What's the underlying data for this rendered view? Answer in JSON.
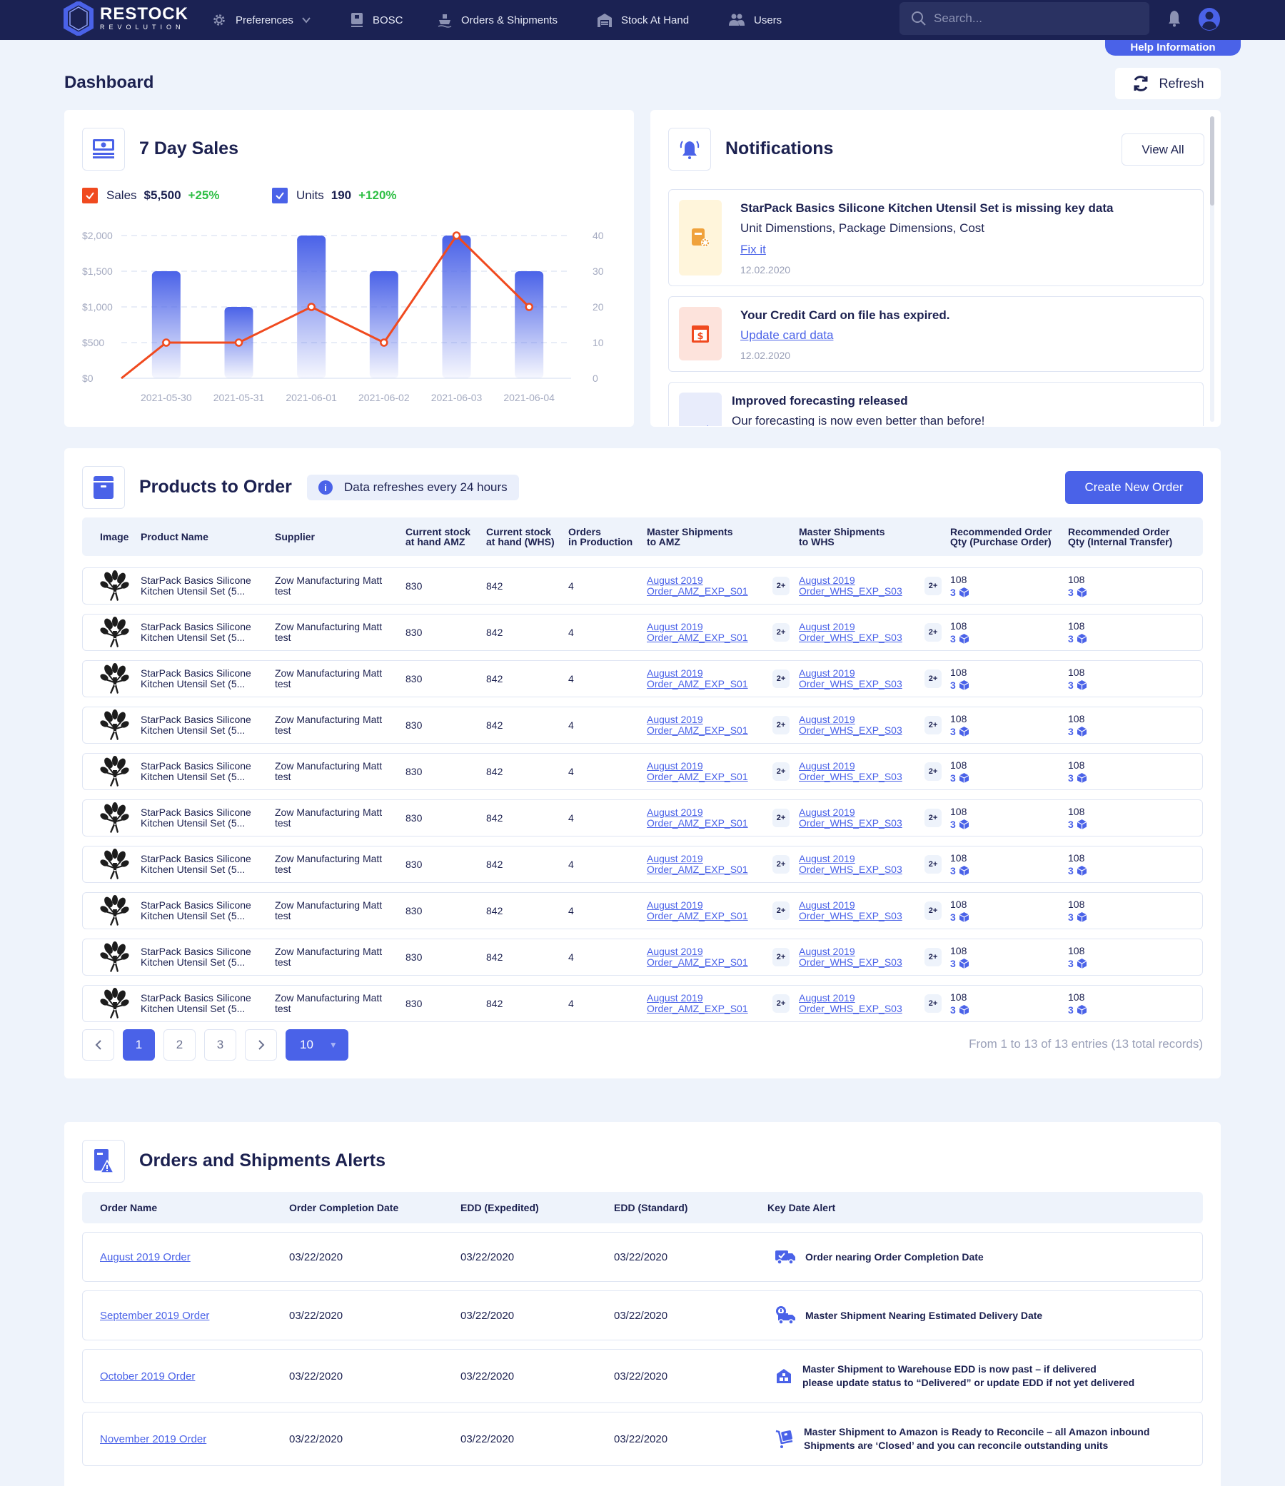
{
  "nav": {
    "logo_main": "RESTOCK",
    "logo_sub": "REVOLUTION",
    "items": [
      {
        "label": "Preferences",
        "icon": "gear-icon",
        "has_dropdown": true
      },
      {
        "label": "BOSC",
        "icon": "book-icon"
      },
      {
        "label": "Orders & Shipments",
        "icon": "ship-icon"
      },
      {
        "label": "Stock At Hand",
        "icon": "warehouse-icon"
      },
      {
        "label": "Users",
        "icon": "users-icon"
      }
    ],
    "search_placeholder": "Search...",
    "help_label": "Help Information"
  },
  "page": {
    "title": "Dashboard",
    "refresh_label": "Refresh"
  },
  "sales": {
    "title": "7 Day Sales",
    "legend": [
      {
        "label": "Sales",
        "value": "$5,500",
        "change": "+25%",
        "color": "#f04a1f"
      },
      {
        "label": "Units",
        "value": "190",
        "change": "+120%",
        "color": "#4a62e8"
      }
    ]
  },
  "chart_data": {
    "type": "bar",
    "title": "7 Day Sales",
    "categories": [
      "2021-05-30",
      "2021-05-31",
      "2021-06-01",
      "2021-06-02",
      "2021-06-03",
      "2021-06-04"
    ],
    "series": [
      {
        "name": "Sales",
        "type": "bar",
        "axis": "left",
        "values": [
          1500,
          1000,
          2000,
          1500,
          2000,
          1500
        ],
        "color": "#4a62e8"
      },
      {
        "name": "Units",
        "type": "line",
        "axis": "right",
        "start_value": 0,
        "values": [
          10,
          10,
          20,
          10,
          40,
          20
        ],
        "color": "#f04a1f"
      }
    ],
    "y_left": {
      "ticks": [
        "$0",
        "$500",
        "$1,000",
        "$1,500",
        "$2,000"
      ],
      "range": [
        0,
        2000
      ]
    },
    "y_right": {
      "ticks": [
        "0",
        "10",
        "20",
        "30",
        "40"
      ],
      "range": [
        0,
        40
      ]
    },
    "grid": true,
    "xlabel": "",
    "ylabel": ""
  },
  "notifications": {
    "title": "Notifications",
    "view_all_label": "View All",
    "items": [
      {
        "title": "StarPack Basics Silicone Kitchen Utensil Set is missing key data",
        "text": "Unit Dimenstions, Package Dimensions, Cost",
        "link": "Fix it",
        "date": "12.02.2020",
        "icon": "document-gear-icon",
        "bg": "#fff5db",
        "fg": "#f0a23c"
      },
      {
        "title": "Your Credit Card on file has expired.",
        "text": "",
        "link": "Update card data",
        "date": "12.02.2020",
        "icon": "card-dollar-icon",
        "bg": "#fde3dc",
        "fg": "#f04a1f"
      },
      {
        "title": "Improved forecasting released",
        "text": "Our forecasting is now even better than before!",
        "link": "",
        "date": "",
        "icon": "chart-icon",
        "bg": "#e8ecfb",
        "fg": "#4a62e8"
      }
    ]
  },
  "products": {
    "title": "Products to Order",
    "info": "Data refreshes every 24 hours",
    "create_label": "Create New Order",
    "headers": [
      "Image",
      "Product Name",
      "Supplier",
      "Current stock\nat hand AMZ",
      "Current stock\nat hand (WHS)",
      "Orders\nin Production",
      "Master Shipments\nto AMZ",
      "Master Shipments\nto WHS",
      "Recommended Order\nQty (Purchase Order)",
      "Recommended Order\nQty (Internal Transfer)"
    ],
    "rows": [
      {
        "name1": "StarPack Basics Silicone",
        "name2": "Kitchen Utensil Set (5...",
        "supplier1": "Zow Manufacturing Matt",
        "supplier2": "test",
        "amz": "830",
        "whs": "842",
        "prod": "4",
        "ms_amz1": "August 2019",
        "ms_amz2": "Order_AMZ_EXP_S01",
        "ms_amz_more": "2+",
        "ms_whs1": "August 2019",
        "ms_whs2": "Order_WHS_EXP_S03",
        "ms_whs_more": "2+",
        "po_qty": "108",
        "po_boxes": "3",
        "it_qty": "108",
        "it_boxes": "3"
      },
      {
        "name1": "StarPack Basics Silicone",
        "name2": "Kitchen Utensil Set (5...",
        "supplier1": "Zow Manufacturing Matt",
        "supplier2": "test",
        "amz": "830",
        "whs": "842",
        "prod": "4",
        "ms_amz1": "August 2019",
        "ms_amz2": "Order_AMZ_EXP_S01",
        "ms_amz_more": "2+",
        "ms_whs1": "August 2019",
        "ms_whs2": "Order_WHS_EXP_S03",
        "ms_whs_more": "2+",
        "po_qty": "108",
        "po_boxes": "3",
        "it_qty": "108",
        "it_boxes": "3"
      },
      {
        "name1": "StarPack Basics Silicone",
        "name2": "Kitchen Utensil Set (5...",
        "supplier1": "Zow Manufacturing Matt",
        "supplier2": "test",
        "amz": "830",
        "whs": "842",
        "prod": "4",
        "ms_amz1": "August 2019",
        "ms_amz2": "Order_AMZ_EXP_S01",
        "ms_amz_more": "2+",
        "ms_whs1": "August 2019",
        "ms_whs2": "Order_WHS_EXP_S03",
        "ms_whs_more": "2+",
        "po_qty": "108",
        "po_boxes": "3",
        "it_qty": "108",
        "it_boxes": "3"
      },
      {
        "name1": "StarPack Basics Silicone",
        "name2": "Kitchen Utensil Set (5...",
        "supplier1": "Zow Manufacturing Matt",
        "supplier2": "test",
        "amz": "830",
        "whs": "842",
        "prod": "4",
        "ms_amz1": "August 2019",
        "ms_amz2": "Order_AMZ_EXP_S01",
        "ms_amz_more": "2+",
        "ms_whs1": "August 2019",
        "ms_whs2": "Order_WHS_EXP_S03",
        "ms_whs_more": "2+",
        "po_qty": "108",
        "po_boxes": "3",
        "it_qty": "108",
        "it_boxes": "3"
      },
      {
        "name1": "StarPack Basics Silicone",
        "name2": "Kitchen Utensil Set (5...",
        "supplier1": "Zow Manufacturing Matt",
        "supplier2": "test",
        "amz": "830",
        "whs": "842",
        "prod": "4",
        "ms_amz1": "August 2019",
        "ms_amz2": "Order_AMZ_EXP_S01",
        "ms_amz_more": "2+",
        "ms_whs1": "August 2019",
        "ms_whs2": "Order_WHS_EXP_S03",
        "ms_whs_more": "2+",
        "po_qty": "108",
        "po_boxes": "3",
        "it_qty": "108",
        "it_boxes": "3"
      },
      {
        "name1": "StarPack Basics Silicone",
        "name2": "Kitchen Utensil Set (5...",
        "supplier1": "Zow Manufacturing Matt",
        "supplier2": "test",
        "amz": "830",
        "whs": "842",
        "prod": "4",
        "ms_amz1": "August 2019",
        "ms_amz2": "Order_AMZ_EXP_S01",
        "ms_amz_more": "2+",
        "ms_whs1": "August 2019",
        "ms_whs2": "Order_WHS_EXP_S03",
        "ms_whs_more": "2+",
        "po_qty": "108",
        "po_boxes": "3",
        "it_qty": "108",
        "it_boxes": "3"
      },
      {
        "name1": "StarPack Basics Silicone",
        "name2": "Kitchen Utensil Set (5...",
        "supplier1": "Zow Manufacturing Matt",
        "supplier2": "test",
        "amz": "830",
        "whs": "842",
        "prod": "4",
        "ms_amz1": "August 2019",
        "ms_amz2": "Order_AMZ_EXP_S01",
        "ms_amz_more": "2+",
        "ms_whs1": "August 2019",
        "ms_whs2": "Order_WHS_EXP_S03",
        "ms_whs_more": "2+",
        "po_qty": "108",
        "po_boxes": "3",
        "it_qty": "108",
        "it_boxes": "3"
      },
      {
        "name1": "StarPack Basics Silicone",
        "name2": "Kitchen Utensil Set (5...",
        "supplier1": "Zow Manufacturing Matt",
        "supplier2": "test",
        "amz": "830",
        "whs": "842",
        "prod": "4",
        "ms_amz1": "August 2019",
        "ms_amz2": "Order_AMZ_EXP_S01",
        "ms_amz_more": "2+",
        "ms_whs1": "August 2019",
        "ms_whs2": "Order_WHS_EXP_S03",
        "ms_whs_more": "2+",
        "po_qty": "108",
        "po_boxes": "3",
        "it_qty": "108",
        "it_boxes": "3"
      },
      {
        "name1": "StarPack Basics Silicone",
        "name2": "Kitchen Utensil Set (5...",
        "supplier1": "Zow Manufacturing Matt",
        "supplier2": "test",
        "amz": "830",
        "whs": "842",
        "prod": "4",
        "ms_amz1": "August 2019",
        "ms_amz2": "Order_AMZ_EXP_S01",
        "ms_amz_more": "2+",
        "ms_whs1": "August 2019",
        "ms_whs2": "Order_WHS_EXP_S03",
        "ms_whs_more": "2+",
        "po_qty": "108",
        "po_boxes": "3",
        "it_qty": "108",
        "it_boxes": "3"
      },
      {
        "name1": "StarPack Basics Silicone",
        "name2": "Kitchen Utensil Set (5...",
        "supplier1": "Zow Manufacturing Matt",
        "supplier2": "test",
        "amz": "830",
        "whs": "842",
        "prod": "4",
        "ms_amz1": "August 2019",
        "ms_amz2": "Order_AMZ_EXP_S01",
        "ms_amz_more": "2+",
        "ms_whs1": "August 2019",
        "ms_whs2": "Order_WHS_EXP_S03",
        "ms_whs_more": "2+",
        "po_qty": "108",
        "po_boxes": "3",
        "it_qty": "108",
        "it_boxes": "3"
      }
    ],
    "pagination": {
      "prev": "‹",
      "pages": [
        "1",
        "2",
        "3"
      ],
      "active_page": "1",
      "next": "›",
      "page_size": "10",
      "entries": "From 1 to 13 of 13 entries (13 total records)"
    }
  },
  "alerts": {
    "title": "Orders and Shipments Alerts",
    "headers": [
      "Order Name",
      "Order Completion Date",
      "EDD (Expedited)",
      "EDD (Standard)",
      "Key Date Alert"
    ],
    "rows": [
      {
        "order": "August 2019 Order",
        "completion": "03/22/2020",
        "edd_exp": "03/22/2020",
        "edd_std": "03/22/2020",
        "icon": "truck-check-icon",
        "alert1": "Order nearing Order Completion Date",
        "alert2": ""
      },
      {
        "order": "September 2019 Order",
        "completion": "03/22/2020",
        "edd_exp": "03/22/2020",
        "edd_std": "03/22/2020",
        "icon": "truck-clock-icon",
        "alert1": "Master Shipment Nearing Estimated Delivery Date",
        "alert2": ""
      },
      {
        "order": "October 2019 Order",
        "completion": "03/22/2020",
        "edd_exp": "03/22/2020",
        "edd_std": "03/22/2020",
        "icon": "warehouse-icon",
        "alert1": "Master Shipment to Warehouse EDD is now past – if delivered",
        "alert2": "please update status to “Delivered” or update EDD if not yet delivered"
      },
      {
        "order": "November 2019 Order",
        "completion": "03/22/2020",
        "edd_exp": "03/22/2020",
        "edd_std": "03/22/2020",
        "icon": "hand-truck-icon",
        "alert1": "Master Shipment to Amazon is Ready to Reconcile – all Amazon inbound",
        "alert2": "Shipments are ‘Closed’ and you can reconcile outstanding units"
      }
    ]
  }
}
